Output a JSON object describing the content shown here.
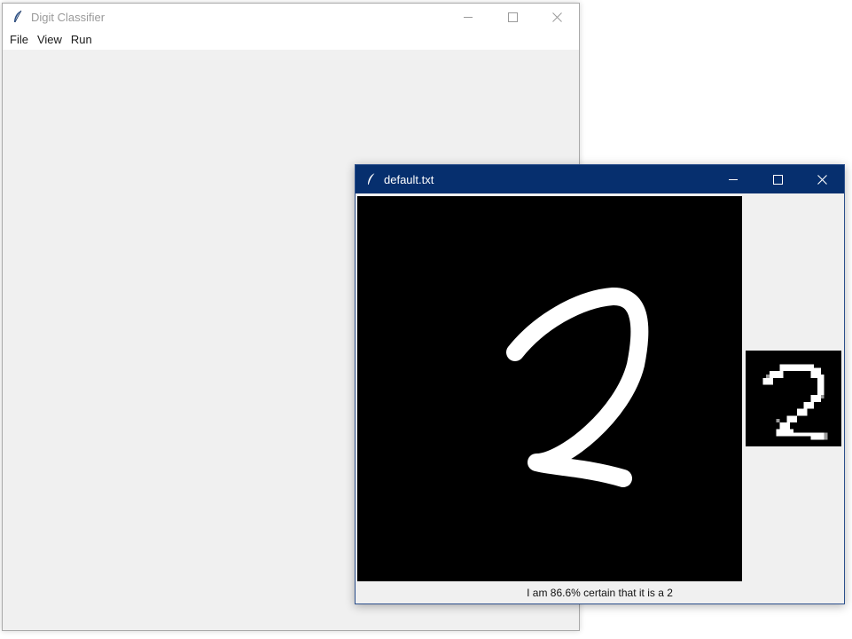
{
  "main_window": {
    "title": "Digit Classifier",
    "menu": [
      "File",
      "View",
      "Run"
    ],
    "controls": {
      "minimize": "minimize-icon",
      "maximize": "maximize-icon",
      "close": "close-icon"
    },
    "icon": "feather-icon"
  },
  "popup_window": {
    "title": "default.txt",
    "icon": "feather-icon",
    "controls": {
      "minimize": "minimize-icon",
      "maximize": "maximize-icon",
      "close": "close-icon"
    },
    "drawn_digit": "2",
    "result_text": "I am 86.6% certain that it is a 2"
  },
  "colors": {
    "active_titlebar": "#062f6e",
    "window_bg": "#f0f0f0",
    "canvas_bg": "#000000",
    "stroke": "#ffffff"
  }
}
